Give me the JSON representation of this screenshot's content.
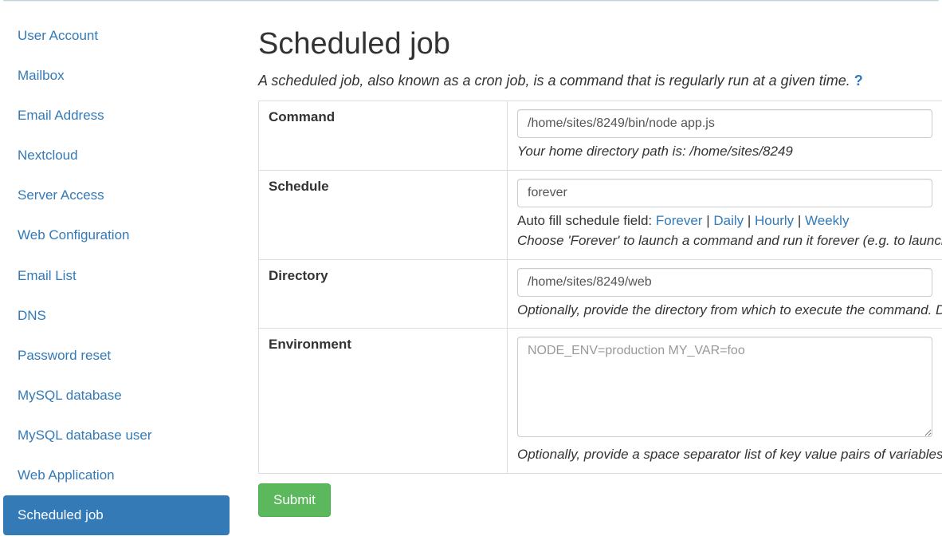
{
  "sidebar": {
    "items": [
      {
        "label": "User Account",
        "active": false
      },
      {
        "label": "Mailbox",
        "active": false
      },
      {
        "label": "Email Address",
        "active": false
      },
      {
        "label": "Nextcloud",
        "active": false
      },
      {
        "label": "Server Access",
        "active": false
      },
      {
        "label": "Web Configuration",
        "active": false
      },
      {
        "label": "Email List",
        "active": false
      },
      {
        "label": "DNS",
        "active": false
      },
      {
        "label": "Password reset",
        "active": false
      },
      {
        "label": "MySQL database",
        "active": false
      },
      {
        "label": "MySQL database user",
        "active": false
      },
      {
        "label": "Web Application",
        "active": false
      },
      {
        "label": "Scheduled job",
        "active": true
      }
    ]
  },
  "page": {
    "title": "Scheduled job",
    "description": "A scheduled job, also known as a cron job, is a command that is regularly run at a given time.",
    "help_icon": "?"
  },
  "form": {
    "command": {
      "label": "Command",
      "value": "/home/sites/8249/bin/node app.js",
      "helper": "Your home directory path is: /home/sites/8249"
    },
    "schedule": {
      "label": "Schedule",
      "value": "forever",
      "autofill_label": "Auto fill schedule field:",
      "options": [
        "Forever",
        "Daily",
        "Hourly",
        "Weekly"
      ],
      "sep": " | ",
      "helper": "Choose 'Forever' to launch a command and run it forever (e.g. to launch a server). Otherwise, choose a period to run the command repeatedly according to a schedule. You may also enter any calendar spec."
    },
    "directory": {
      "label": "Directory",
      "value": "/home/sites/8249/web",
      "helper": "Optionally, provide the directory from which to execute the command. Defaults to your home directory."
    },
    "environment": {
      "label": "Environment",
      "placeholder": "NODE_ENV=production MY_VAR=foo",
      "value": "",
      "helper": "Optionally, provide a space separator list of key value pairs of variables that will be set in the environment."
    },
    "submit": "Submit"
  }
}
